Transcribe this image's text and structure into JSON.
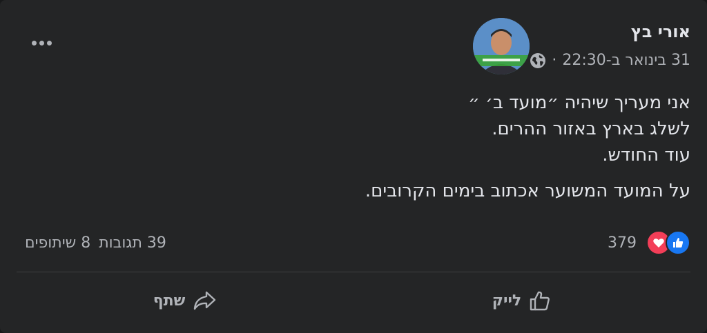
{
  "post": {
    "author": "אורי בץ",
    "timestamp": "31 בינואר ב-22:30",
    "separator": "·",
    "privacy_icon": "globe-icon",
    "more_icon": "more-options-icon",
    "content": {
      "lines": [
        "אני מעריך שיהיה ״מועד ב׳ ״",
        "לשלג בארץ באזור ההרים.",
        "עוד החודש."
      ],
      "paragraph2": "על המועד המשוער אכתוב בימים הקרובים."
    },
    "reactions": {
      "icons": [
        "like-reaction-icon",
        "love-reaction-icon"
      ],
      "count": "379"
    },
    "counts": {
      "comments": "39 תגובות",
      "shares": "8 שיתופים"
    },
    "actions": {
      "like_label": "לייק",
      "share_label": "שתף"
    }
  },
  "colors": {
    "background": "#242526",
    "text": "#e4e6eb",
    "secondary_text": "#b0b3b8",
    "like_blue": "#1877f2",
    "love_red": "#f33e58"
  }
}
